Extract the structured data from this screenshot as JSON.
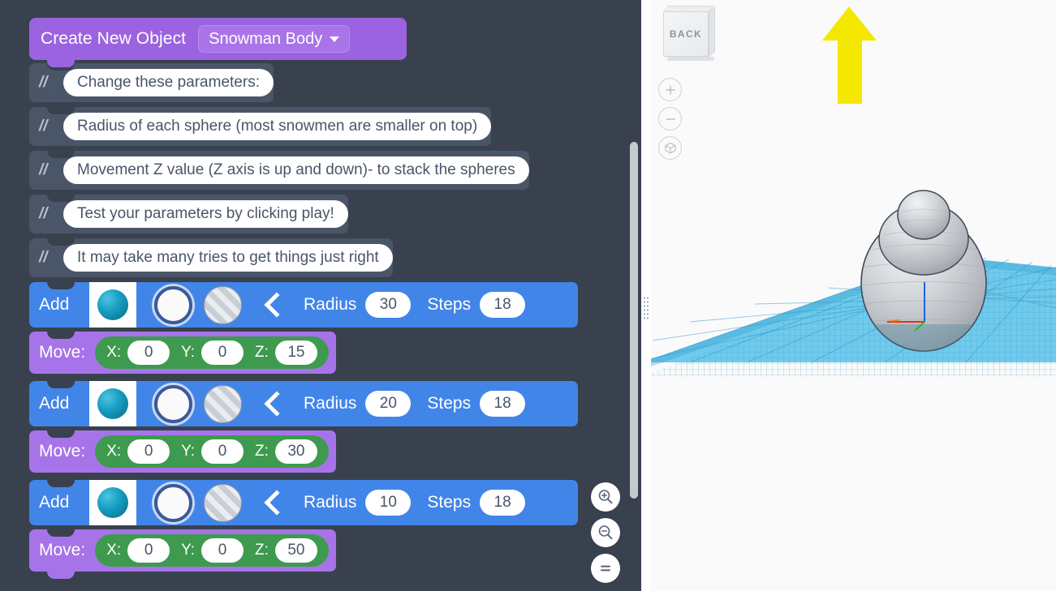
{
  "code_panel": {
    "hat_block": {
      "title": "Create New Object",
      "object_name": "Snowman Body",
      "caret_icon": "chevron-down-icon"
    },
    "comment_prefix": "//",
    "comments": [
      "Change these parameters:",
      "Radius of each sphere (most snowmen are smaller on top)",
      "Movement Z value (Z axis is up and down)- to stack the spheres",
      "Test your parameters by clicking play!",
      "It may take many tries to get things just right"
    ],
    "add_block": {
      "label": "Add",
      "radius_label": "Radius",
      "steps_label": "Steps",
      "shape_icons": [
        "sphere-solid-icon",
        "circle-outline-icon",
        "circle-striped-icon"
      ],
      "prev_icon": "chevron-left-icon"
    },
    "move_block": {
      "label": "Move:",
      "x_label": "X:",
      "y_label": "Y:",
      "z_label": "Z:"
    },
    "program": [
      {
        "type": "add",
        "radius": "30",
        "steps": "18"
      },
      {
        "type": "move",
        "x": "0",
        "y": "0",
        "z": "15"
      },
      {
        "type": "add",
        "radius": "20",
        "steps": "18"
      },
      {
        "type": "move",
        "x": "0",
        "y": "0",
        "z": "30"
      },
      {
        "type": "add",
        "radius": "10",
        "steps": "18"
      },
      {
        "type": "move",
        "x": "0",
        "y": "0",
        "z": "50"
      }
    ],
    "zoom_controls": [
      {
        "name": "zoom-in-button",
        "icon": "magnifier-plus-icon"
      },
      {
        "name": "zoom-out-button",
        "icon": "magnifier-minus-icon"
      },
      {
        "name": "zoom-reset-button",
        "icon": "equals-icon"
      }
    ],
    "colors": {
      "panel_background": "#39414f",
      "hat_purple": "#9b63e0",
      "move_purple": "#a674e8",
      "add_blue": "#4285e8",
      "xyz_green": "#3e9a4e",
      "comment_gray": "#4a5568",
      "pill_white": "#ffffff"
    }
  },
  "viewport": {
    "view_cube_label": "BACK",
    "nav_buttons": [
      {
        "name": "zoom-in-button",
        "icon": "plus-icon"
      },
      {
        "name": "zoom-out-button",
        "icon": "minus-icon"
      },
      {
        "name": "fit-view-button",
        "icon": "cube-fit-icon"
      }
    ],
    "annotation_arrow": "yellow-up-arrow",
    "model": {
      "name": "snowman-body",
      "spheres": 3,
      "axis_gizmo": "rgb-axis-gizmo"
    },
    "colors": {
      "background": "#fafafa",
      "build_plate": "#4fc3e8",
      "model_gray": "#c9ccd0",
      "arrow_yellow": "#f5e800"
    }
  }
}
